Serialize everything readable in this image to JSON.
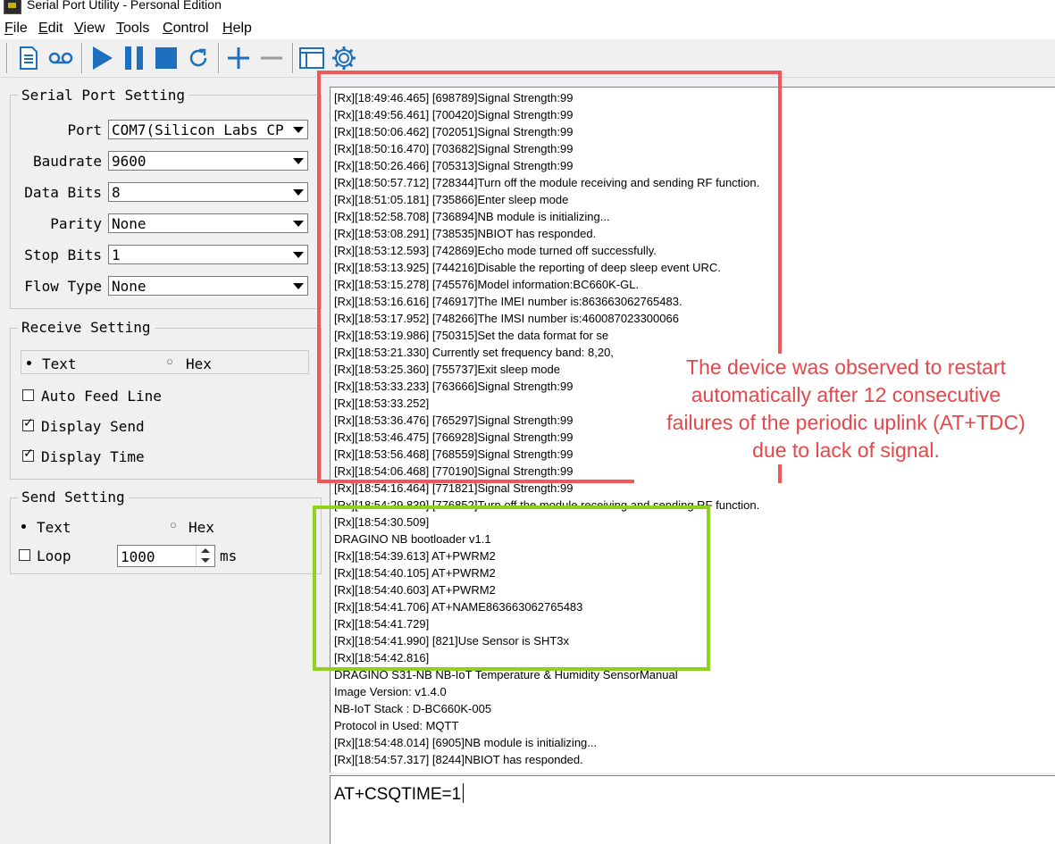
{
  "window": {
    "title": "Serial Port Utility - Personal Edition"
  },
  "menu": [
    {
      "label": "File",
      "underline": "F"
    },
    {
      "label": "Edit",
      "underline": "E"
    },
    {
      "label": "View",
      "underline": "V"
    },
    {
      "label": "Tools",
      "underline": "T"
    },
    {
      "label": "Control",
      "underline": "C"
    },
    {
      "label": "Help",
      "underline": "H"
    }
  ],
  "toolbar": {
    "icons": [
      "new-document-icon",
      "record-icon",
      "play-icon",
      "pause-icon",
      "stop-icon",
      "refresh-icon",
      "add-icon",
      "remove-icon",
      "window-icon",
      "settings-gear-icon"
    ],
    "accent": "#1f6fbf"
  },
  "serial_setting": {
    "title": "Serial Port Setting",
    "port": {
      "label": "Port",
      "value": "COM7(Silicon Labs CP"
    },
    "baudrate": {
      "label": "Baudrate",
      "value": "9600"
    },
    "data_bits": {
      "label": "Data Bits",
      "value": "8"
    },
    "parity": {
      "label": "Parity",
      "value": "None"
    },
    "stop_bits": {
      "label": "Stop Bits",
      "value": "1"
    },
    "flow_type": {
      "label": "Flow Type",
      "value": "None"
    }
  },
  "receive_setting": {
    "title": "Receive Setting",
    "text_label": "Text",
    "hex_label": "Hex",
    "mode_selected": "Text",
    "auto_feed": {
      "label": "Auto Feed Line",
      "checked": false
    },
    "display_send": {
      "label": "Display Send",
      "checked": true
    },
    "display_time": {
      "label": "Display Time",
      "checked": true
    }
  },
  "send_setting": {
    "title": "Send Setting",
    "text_label": "Text",
    "hex_label": "Hex",
    "mode_selected": "Text",
    "loop": {
      "label": "Loop",
      "checked": false
    },
    "interval": "1000",
    "unit": "ms"
  },
  "log": [
    "[Rx][18:49:46.465] [698789]Signal Strength:99",
    "[Rx][18:49:56.461] [700420]Signal Strength:99",
    "[Rx][18:50:06.462] [702051]Signal Strength:99",
    "[Rx][18:50:16.470] [703682]Signal Strength:99",
    "[Rx][18:50:26.466] [705313]Signal Strength:99",
    "[Rx][18:50:57.712] [728344]Turn off the module receiving and sending RF function.",
    "[Rx][18:51:05.181] [735866]Enter sleep mode",
    "[Rx][18:52:58.708] [736894]NB module is initializing...",
    "[Rx][18:53:08.291] [738535]NBIOT has responded.",
    "[Rx][18:53:12.593] [742869]Echo mode turned off successfully.",
    "[Rx][18:53:13.925] [744216]Disable the reporting of deep sleep event URC.",
    "[Rx][18:53:15.278] [745576]Model information:BC660K-GL.",
    "[Rx][18:53:16.616] [746917]The IMEI number is:863663062765483.",
    "[Rx][18:53:17.952] [748266]The IMSI number is:460087023300066",
    "[Rx][18:53:19.986] [750315]Set the data format for se",
    "[Rx][18:53:21.330] Currently set frequency band: 8,20,",
    "[Rx][18:53:25.360] [755737]Exit sleep mode",
    "[Rx][18:53:33.233] [763666]Signal Strength:99",
    "[Rx][18:53:33.252]",
    "[Rx][18:53:36.476] [765297]Signal Strength:99",
    "[Rx][18:53:46.475] [766928]Signal Strength:99",
    "[Rx][18:53:56.468] [768559]Signal Strength:99",
    "[Rx][18:54:06.468] [770190]Signal Strength:99",
    "[Rx][18:54:16.464] [771821]Signal Strength:99",
    "[Rx][18:54:29.839] [776852]Turn off the module receiving and sending RF function.",
    "[Rx][18:54:30.509]",
    "DRAGINO NB bootloader v1.1",
    "[Rx][18:54:39.613] AT+PWRM2",
    "[Rx][18:54:40.105] AT+PWRM2",
    "[Rx][18:54:40.603] AT+PWRM2",
    "[Rx][18:54:41.706] AT+NAME863663062765483",
    "[Rx][18:54:41.729]",
    "[Rx][18:54:41.990] [821]Use Sensor is SHT3x",
    "[Rx][18:54:42.816]",
    "DRAGINO S31-NB NB-IoT Temperature & Humidity SensorManual",
    "Image Version: v1.4.0",
    "NB-IoT Stack : D-BC660K-005",
    "Protocol in Used: MQTT",
    "[Rx][18:54:48.014] [6905]NB module is initializing...",
    "[Rx][18:54:57.317] [8244]NBIOT has responded."
  ],
  "send_input": {
    "value": "AT+CSQTIME=1"
  },
  "annotation": {
    "lines": [
      "The device was observed to restart",
      "automatically after 12 consecutive",
      "failures of the periodic uplink (AT+TDC)",
      "due to lack of signal."
    ],
    "color": "#e5474a",
    "highlight_red": "#f25757",
    "highlight_green": "#8fd21b"
  }
}
